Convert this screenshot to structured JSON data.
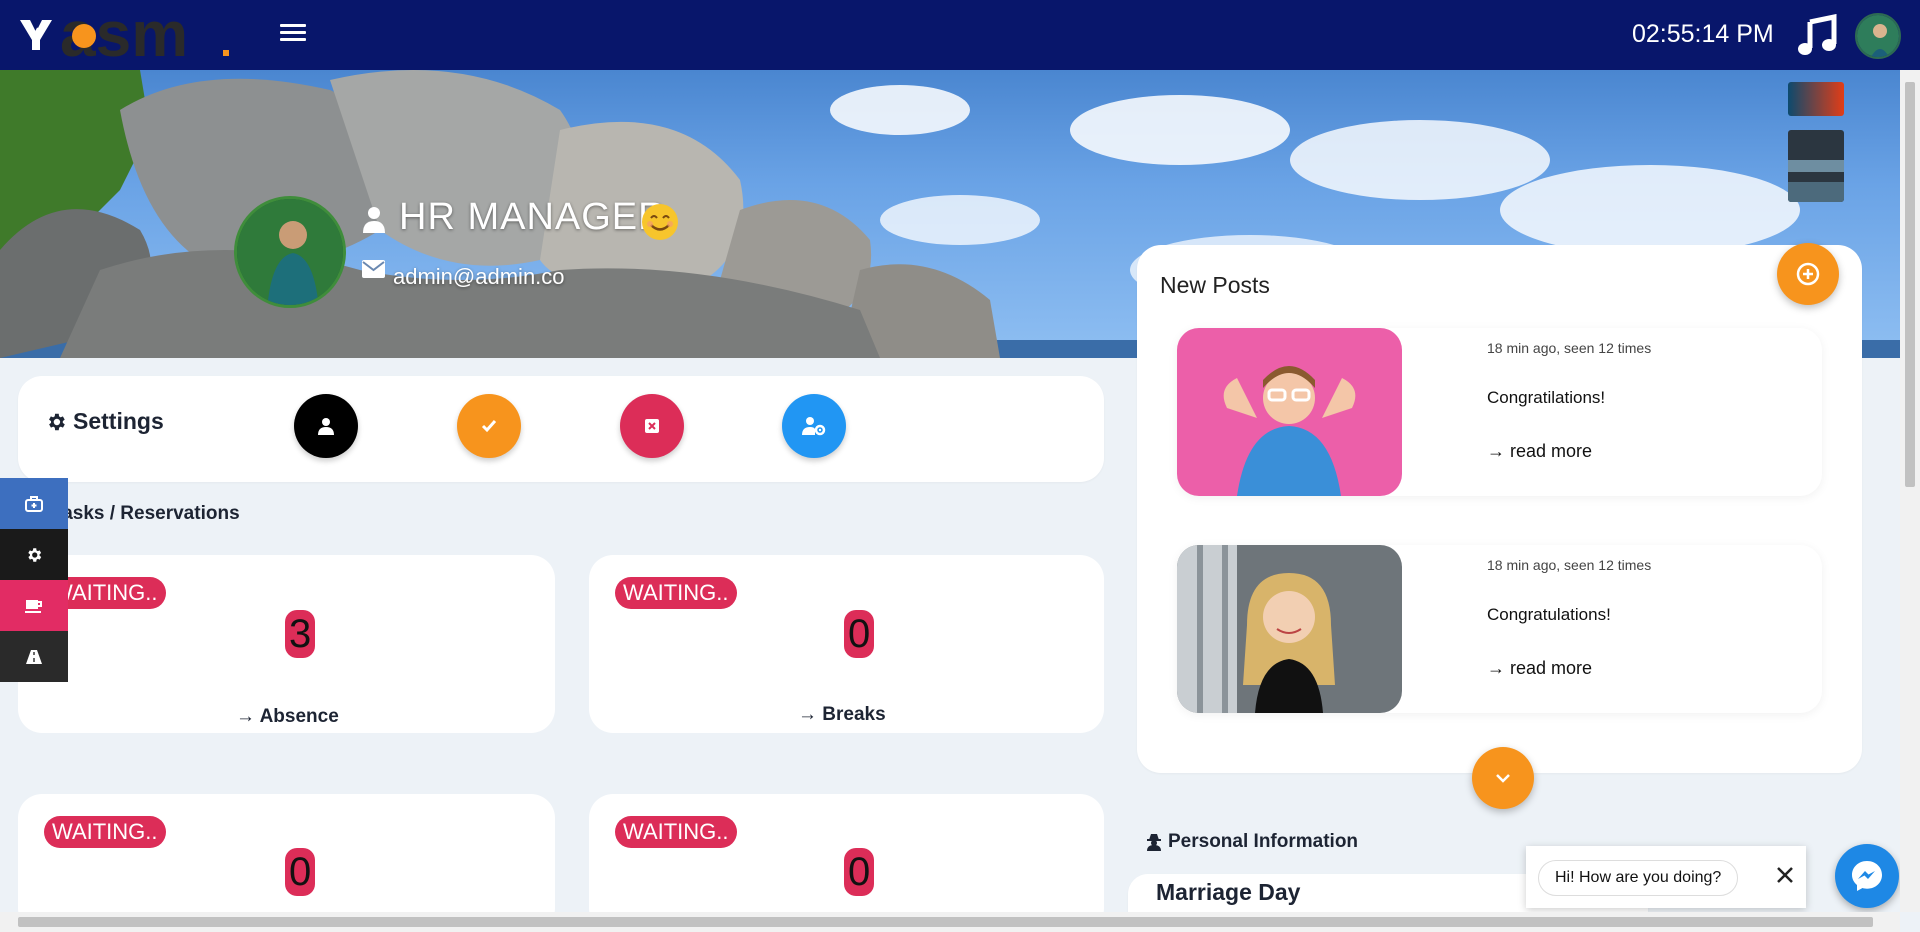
{
  "header": {
    "logo_text": "asm",
    "clock": "02:55:14 PM"
  },
  "profile": {
    "name": "HR MANAGER",
    "email": "admin@admin.co"
  },
  "settings": {
    "title": "Settings"
  },
  "tasks": {
    "section_title": "Tasks / Reservations",
    "cards": [
      {
        "status": "WAITING..",
        "count": "3",
        "link": "→ Absence"
      },
      {
        "status": "WAITING..",
        "count": "0",
        "link": "→ Breaks"
      },
      {
        "status": "WAITING..",
        "count": "0",
        "link": ""
      },
      {
        "status": "WAITING..",
        "count": "0",
        "link": ""
      }
    ]
  },
  "posts": {
    "title": "New Posts",
    "items": [
      {
        "meta": "18 min ago, seen 12 times",
        "text": "Congratilations!",
        "more": "→ read more"
      },
      {
        "meta": "18 min ago, seen 12 times",
        "text": "Congratulations!",
        "more": "→ read more"
      }
    ]
  },
  "personal_info": {
    "title": "Personal Information",
    "card_title": "Marriage Day"
  },
  "chat": {
    "greeting": "Hi! How are you doing?"
  },
  "colors": {
    "topbar": "#08166b",
    "accent_orange": "#f7941d",
    "accent_pink": "#dc2d58",
    "accent_blue": "#2196f3"
  }
}
